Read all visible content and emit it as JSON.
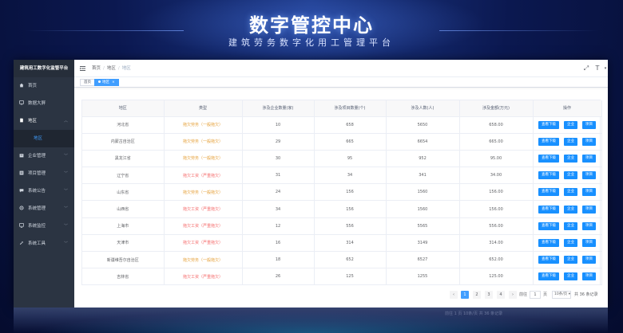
{
  "hero": {
    "title": "数字管控中心",
    "subtitle": "建筑劳务数字化用工管理平台"
  },
  "sidebar": {
    "brand": "建筑用工数字化监管平台",
    "items": [
      {
        "label": "首页",
        "icon": "home-icon"
      },
      {
        "label": "数据大屏",
        "icon": "dashboard-icon"
      },
      {
        "label": "地区",
        "icon": "doc-icon",
        "open": true
      },
      {
        "label": "企业管理",
        "icon": "enterprise-icon"
      },
      {
        "label": "项目管理",
        "icon": "project-icon"
      },
      {
        "label": "系统公告",
        "icon": "notice-icon"
      },
      {
        "label": "系统管理",
        "icon": "settings-icon"
      },
      {
        "label": "系统监控",
        "icon": "monitor-icon"
      },
      {
        "label": "系统工具",
        "icon": "tools-icon"
      }
    ],
    "sub_item": "地区"
  },
  "breadcrumb": [
    "首页",
    "地区",
    "地区"
  ],
  "tags": {
    "home": "首页",
    "active": "地区"
  },
  "table": {
    "headers": [
      "地区",
      "类型",
      "涉及企业数量(家)",
      "涉及项目数量(个)",
      "涉及人数(人)",
      "涉及金额(万元)",
      "操作"
    ],
    "rows": [
      {
        "region": "河北省",
        "type": "拖欠劳务（一般拖欠）",
        "severity": "arrears",
        "companies": "10",
        "projects": "658",
        "people": "5650",
        "amount": "658.00"
      },
      {
        "region": "内蒙古自治区",
        "type": "拖欠劳务（一般拖欠）",
        "severity": "arrears",
        "companies": "29",
        "projects": "665",
        "people": "6654",
        "amount": "665.00"
      },
      {
        "region": "黑龙江省",
        "type": "拖欠劳务（一般拖欠）",
        "severity": "arrears",
        "companies": "30",
        "projects": "95",
        "people": "952",
        "amount": "95.00"
      },
      {
        "region": "辽宁省",
        "type": "拖欠工资（严重拖欠）",
        "severity": "severe",
        "companies": "31",
        "projects": "34",
        "people": "341",
        "amount": "34.00"
      },
      {
        "region": "山东省",
        "type": "拖欠劳务（一般拖欠）",
        "severity": "arrears",
        "companies": "24",
        "projects": "156",
        "people": "1560",
        "amount": "156.00"
      },
      {
        "region": "山西省",
        "type": "拖欠工资（严重拖欠）",
        "severity": "severe",
        "companies": "34",
        "projects": "156",
        "people": "1560",
        "amount": "156.00"
      },
      {
        "region": "上海市",
        "type": "拖欠工资（严重拖欠）",
        "severity": "severe",
        "companies": "12",
        "projects": "556",
        "people": "5565",
        "amount": "556.00"
      },
      {
        "region": "天津市",
        "type": "拖欠工资（严重拖欠）",
        "severity": "severe",
        "companies": "16",
        "projects": "314",
        "people": "3149",
        "amount": "314.00"
      },
      {
        "region": "新疆维吾尔自治区",
        "type": "拖欠劳务（一般拖欠）",
        "severity": "arrears",
        "companies": "18",
        "projects": "652",
        "people": "6527",
        "amount": "652.00"
      },
      {
        "region": "吉林省",
        "type": "拖欠工资（严重拖欠）",
        "severity": "severe",
        "companies": "26",
        "projects": "125",
        "people": "1255",
        "amount": "125.00"
      }
    ],
    "actions": [
      "查看下级",
      "企业",
      "项目"
    ]
  },
  "pagination": {
    "prev": "‹",
    "pages": [
      "1",
      "2",
      "3",
      "4"
    ],
    "next": "›",
    "goto_label": "前往",
    "goto_value": "1",
    "page_unit": "页",
    "page_size": "10条/页",
    "total": "共 36 条记录",
    "current": "1"
  },
  "reflection_text": "前往 1 页 10条/页 共 36 条记录",
  "colors": {
    "primary": "#409eff",
    "button": "#1890ff",
    "sidebar": "#2b3442",
    "arrears": "#e6a23c",
    "severe": "#f56c6c"
  }
}
